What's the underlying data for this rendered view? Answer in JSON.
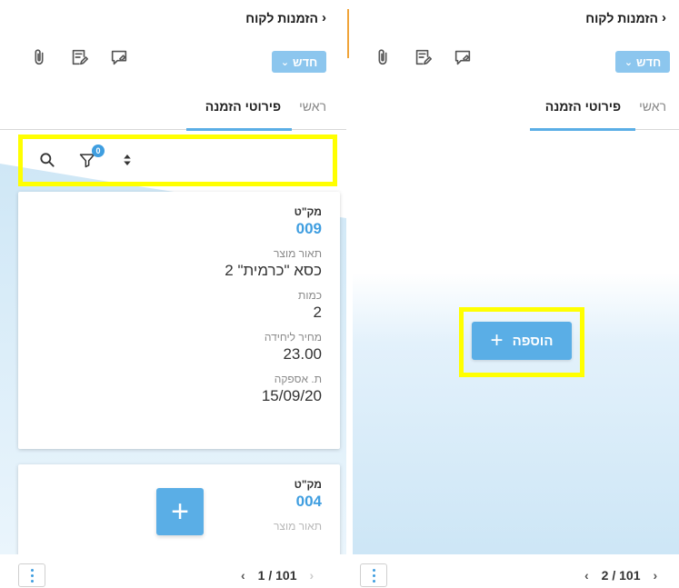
{
  "left": {
    "header": {
      "title": "הזמנות לקוח",
      "back_glyph": "‹"
    },
    "toolbar": {
      "new_label": "חדש",
      "new_chevron": "⌄",
      "icons": [
        "attachment-icon",
        "edit-note-icon",
        "comment-icon"
      ]
    },
    "tabs": [
      {
        "label": "ראשי",
        "active": false
      },
      {
        "label": "פירוטי הזמנה",
        "active": true
      }
    ],
    "searchbar": {
      "filter_count": "0",
      "icons": [
        "search-icon",
        "filter-icon",
        "sort-icon"
      ]
    },
    "cards": [
      {
        "fields": [
          {
            "label": "מק\"ט",
            "value": "009"
          },
          {
            "label": "תאור מוצר",
            "value": "כסא \"כרמית\" 2"
          },
          {
            "label": "כמות",
            "value": "2"
          },
          {
            "label": "מחיר ליחידה",
            "value": "23.00"
          },
          {
            "label": "ת. אספקה",
            "value": "15/09/20"
          }
        ]
      },
      {
        "fields": [
          {
            "label": "מק\"ט",
            "value": "004"
          },
          {
            "label": "תאור מוצר",
            "value": ""
          }
        ]
      }
    ],
    "fab_label": "+",
    "pager": {
      "text": "1 / 101",
      "prev": "‹",
      "next": "›"
    }
  },
  "right": {
    "header": {
      "title": "הזמנות לקוח",
      "back_glyph": "‹"
    },
    "toolbar": {
      "new_label": "חדש",
      "new_chevron": "⌄",
      "icons": [
        "attachment-icon",
        "edit-note-icon",
        "comment-icon"
      ]
    },
    "tabs": [
      {
        "label": "ראשי",
        "active": false
      },
      {
        "label": "פירוטי הזמנה",
        "active": true
      }
    ],
    "add_button": {
      "label": "הוספה",
      "plus": "+"
    },
    "pager": {
      "text": "2 / 101",
      "prev": "‹",
      "next": "›"
    }
  },
  "colors": {
    "accent": "#5aaee6",
    "highlight": "#ffff00",
    "divider": "#f0a43a",
    "link": "#3f9ee0"
  }
}
